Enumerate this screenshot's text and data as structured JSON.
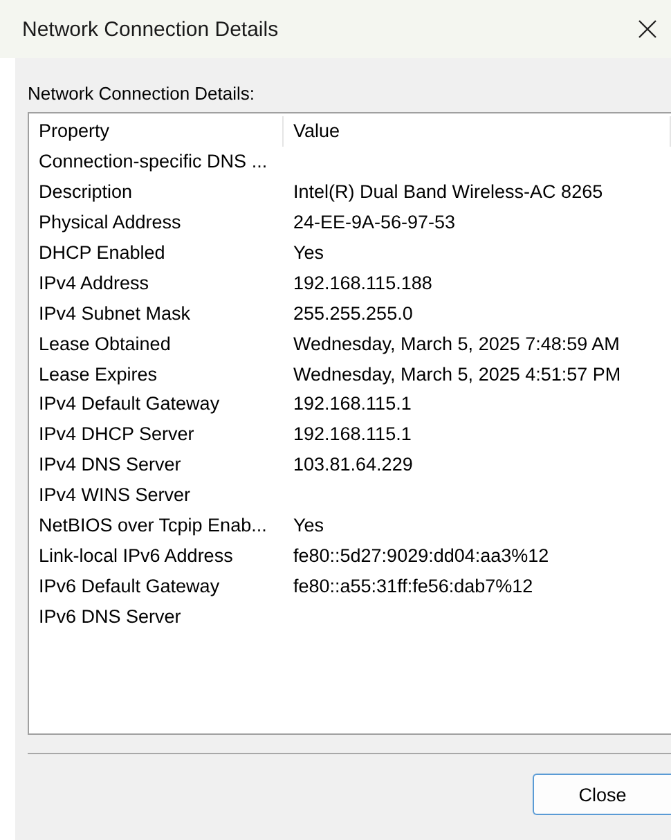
{
  "window": {
    "title": "Network Connection Details"
  },
  "group_label": "Network Connection Details:",
  "table": {
    "columns": [
      "Property",
      "Value"
    ],
    "rows": [
      [
        "Connection-specific DNS ...",
        ""
      ],
      [
        "Description",
        "Intel(R) Dual Band Wireless-AC 8265"
      ],
      [
        "Physical Address",
        "24-EE-9A-56-97-53"
      ],
      [
        "DHCP Enabled",
        "Yes"
      ],
      [
        "IPv4 Address",
        "192.168.115.188"
      ],
      [
        "IPv4 Subnet Mask",
        "255.255.255.0"
      ],
      [
        "Lease Obtained",
        "Wednesday, March 5, 2025 7:48:59 AM"
      ],
      [
        "Lease Expires",
        "Wednesday, March 5, 2025 4:51:57 PM"
      ],
      [
        "IPv4 Default Gateway",
        "192.168.115.1"
      ],
      [
        "IPv4 DHCP Server",
        "192.168.115.1"
      ],
      [
        "IPv4 DNS Server",
        "103.81.64.229"
      ],
      [
        "IPv4 WINS Server",
        ""
      ],
      [
        "NetBIOS over Tcpip Enab...",
        "Yes"
      ],
      [
        "Link-local IPv6 Address",
        "fe80::5d27:9029:dd04:aa3%12"
      ],
      [
        "IPv6 Default Gateway",
        "fe80::a55:31ff:fe56:dab7%12"
      ],
      [
        "IPv6 DNS Server",
        ""
      ]
    ]
  },
  "buttons": [
    "Close"
  ]
}
